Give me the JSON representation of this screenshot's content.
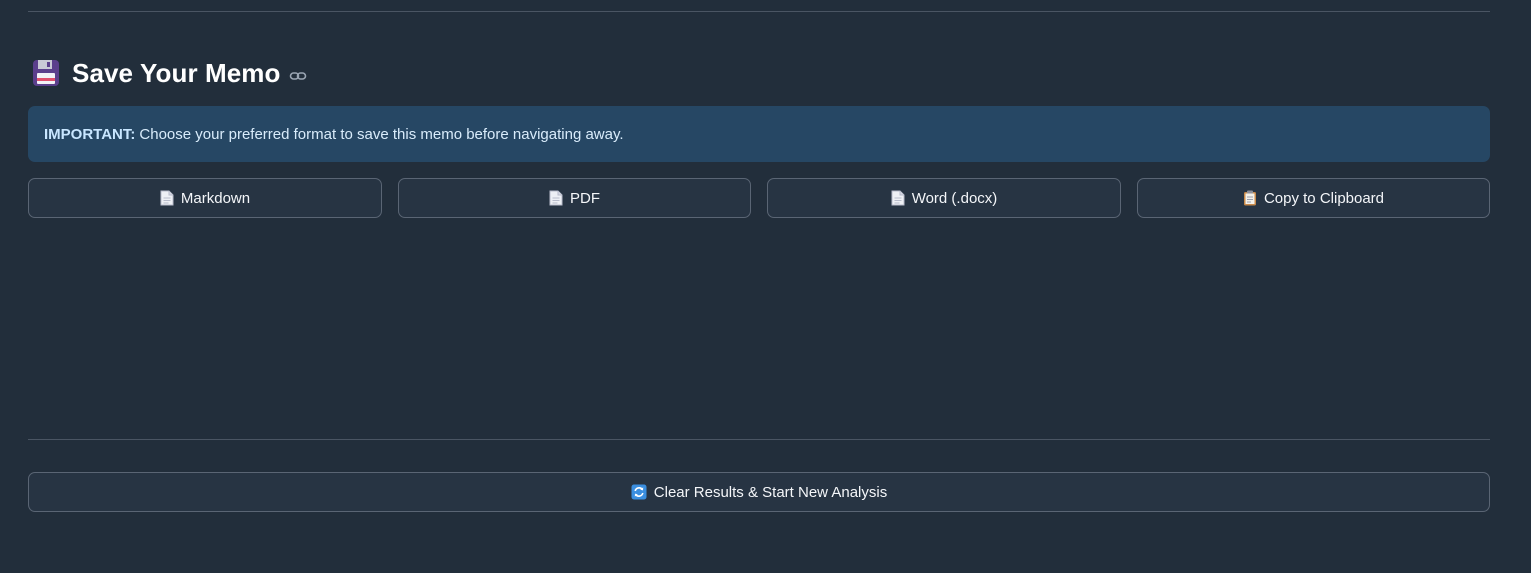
{
  "section": {
    "title": "Save Your Memo",
    "title_icon": "floppy-disk-icon",
    "anchor_icon": "link-icon"
  },
  "alert": {
    "strong": "IMPORTANT:",
    "message": "Choose your preferred format to save this memo before navigating away."
  },
  "export_buttons": [
    {
      "label": "Markdown",
      "icon": "document-icon"
    },
    {
      "label": "PDF",
      "icon": "document-icon"
    },
    {
      "label": "Word (.docx)",
      "icon": "document-icon"
    },
    {
      "label": "Copy to Clipboard",
      "icon": "clipboard-icon"
    }
  ],
  "clear_button": {
    "label": "Clear Results & Start New Analysis",
    "icon": "refresh-icon"
  },
  "colors": {
    "background": "#222e3b",
    "alert_background": "#264764",
    "button_background": "#273443",
    "button_border": "#5a6574"
  }
}
